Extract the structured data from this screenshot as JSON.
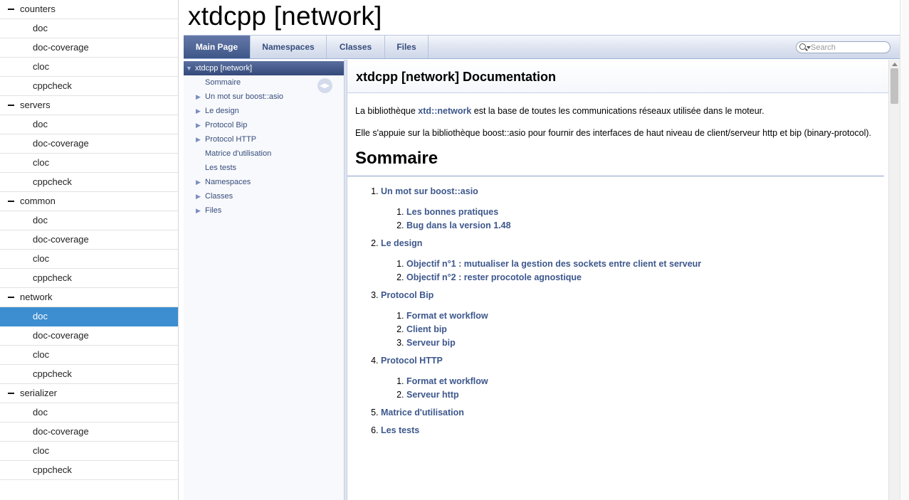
{
  "sidebar": {
    "groups": [
      {
        "name": "counters",
        "items": [
          "doc",
          "doc-coverage",
          "cloc",
          "cppcheck"
        ]
      },
      {
        "name": "servers",
        "items": [
          "doc",
          "doc-coverage",
          "cloc",
          "cppcheck"
        ]
      },
      {
        "name": "common",
        "items": [
          "doc",
          "doc-coverage",
          "cloc",
          "cppcheck"
        ]
      },
      {
        "name": "network",
        "items": [
          "doc",
          "doc-coverage",
          "cloc",
          "cppcheck"
        ]
      },
      {
        "name": "serializer",
        "items": [
          "doc",
          "doc-coverage",
          "cloc",
          "cppcheck"
        ]
      }
    ],
    "selected": {
      "group": "network",
      "item": "doc"
    }
  },
  "project_title": "xtdcpp [network]",
  "tabs": [
    "Main Page",
    "Namespaces",
    "Classes",
    "Files"
  ],
  "active_tab": "Main Page",
  "search": {
    "placeholder": "Search"
  },
  "navtree": {
    "root": "xtdcpp [network]",
    "items": [
      {
        "label": "Sommaire",
        "expandable": false
      },
      {
        "label": "Un mot sur boost::asio",
        "expandable": true
      },
      {
        "label": "Le design",
        "expandable": true
      },
      {
        "label": "Protocol Bip",
        "expandable": true
      },
      {
        "label": "Protocol HTTP",
        "expandable": true
      },
      {
        "label": "Matrice d'utilisation",
        "expandable": false
      },
      {
        "label": "Les tests",
        "expandable": false
      },
      {
        "label": "Namespaces",
        "expandable": true
      },
      {
        "label": "Classes",
        "expandable": true
      },
      {
        "label": "Files",
        "expandable": true
      }
    ]
  },
  "doc": {
    "title": "xtdcpp [network] Documentation",
    "intro1": {
      "before": "La bibliothèque ",
      "link": "xtd::network",
      "after": " est la base de toutes les communications réseaux utilisée dans le moteur."
    },
    "intro2": "Elle s'appuie sur la bibliothèque boost::asio pour fournir des interfaces de haut niveau de client/serveur http et bip (binary-protocol).",
    "sommaire_heading": "Sommaire",
    "toc": [
      {
        "label": "Un mot sur boost::asio",
        "children": [
          "Les bonnes pratiques",
          "Bug dans la version 1.48"
        ]
      },
      {
        "label": "Le design",
        "children": [
          "Objectif n°1 : mutualiser la gestion des sockets entre client et serveur",
          "Objectif n°2 : rester procotole agnostique"
        ]
      },
      {
        "label": "Protocol Bip",
        "children": [
          "Format et workflow",
          "Client bip",
          "Serveur bip"
        ]
      },
      {
        "label": "Protocol HTTP",
        "children": [
          "Format et workflow",
          "Serveur http"
        ]
      },
      {
        "label": "Matrice d'utilisation",
        "children": []
      },
      {
        "label": "Les tests",
        "children": []
      }
    ]
  }
}
